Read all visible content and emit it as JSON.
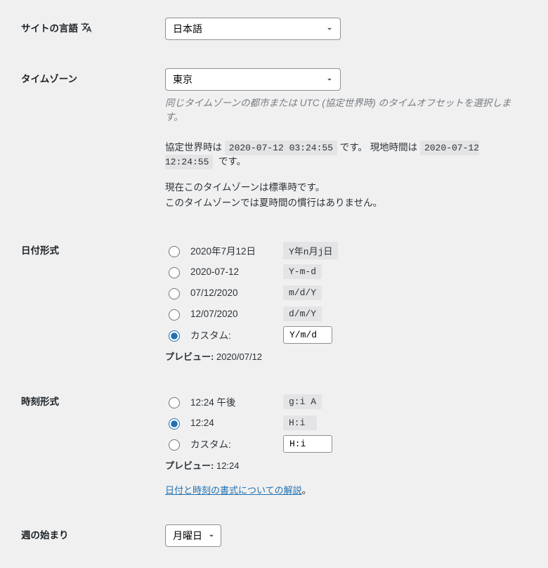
{
  "labels": {
    "siteLanguage": "サイトの言語",
    "timezone": "タイムゾーン",
    "dateFormat": "日付形式",
    "timeFormat": "時刻形式",
    "weekStart": "週の始まり"
  },
  "siteLanguage": {
    "value": "日本語"
  },
  "timezone": {
    "value": "東京",
    "help": "同じタイムゾーンの都市または UTC (協定世界時) のタイムオフセットを選択します。",
    "utcLabel": "協定世界時は",
    "utcTime": "2020-07-12 03:24:55",
    "utcSuffix": "です。",
    "localLabel": "現地時間は",
    "localTime": "2020-07-12 12:24:55",
    "localSuffix": "です。",
    "note1": "現在このタイムゾーンは標準時です。",
    "note2": "このタイムゾーンでは夏時間の慣行はありません。"
  },
  "dateFormat": {
    "options": [
      {
        "sample": "2020年7月12日",
        "format": "Y年n月j日",
        "checked": false
      },
      {
        "sample": "2020-07-12",
        "format": "Y-m-d",
        "checked": false
      },
      {
        "sample": "07/12/2020",
        "format": "m/d/Y",
        "checked": false
      },
      {
        "sample": "12/07/2020",
        "format": "d/m/Y",
        "checked": false
      }
    ],
    "customLabel": "カスタム:",
    "customValue": "Y/m/d",
    "customChecked": true,
    "previewLabel": "プレビュー:",
    "previewValue": "2020/07/12"
  },
  "timeFormat": {
    "options": [
      {
        "sample": "12:24 午後",
        "format": "g:i A",
        "checked": false
      },
      {
        "sample": "12:24",
        "format": "H:i",
        "checked": true
      }
    ],
    "customLabel": "カスタム:",
    "customValue": "H:i",
    "customChecked": false,
    "previewLabel": "プレビュー:",
    "previewValue": "12:24",
    "docLink": "日付と時刻の書式についての解説",
    "docLinkSuffix": "。"
  },
  "weekStart": {
    "value": "月曜日"
  }
}
